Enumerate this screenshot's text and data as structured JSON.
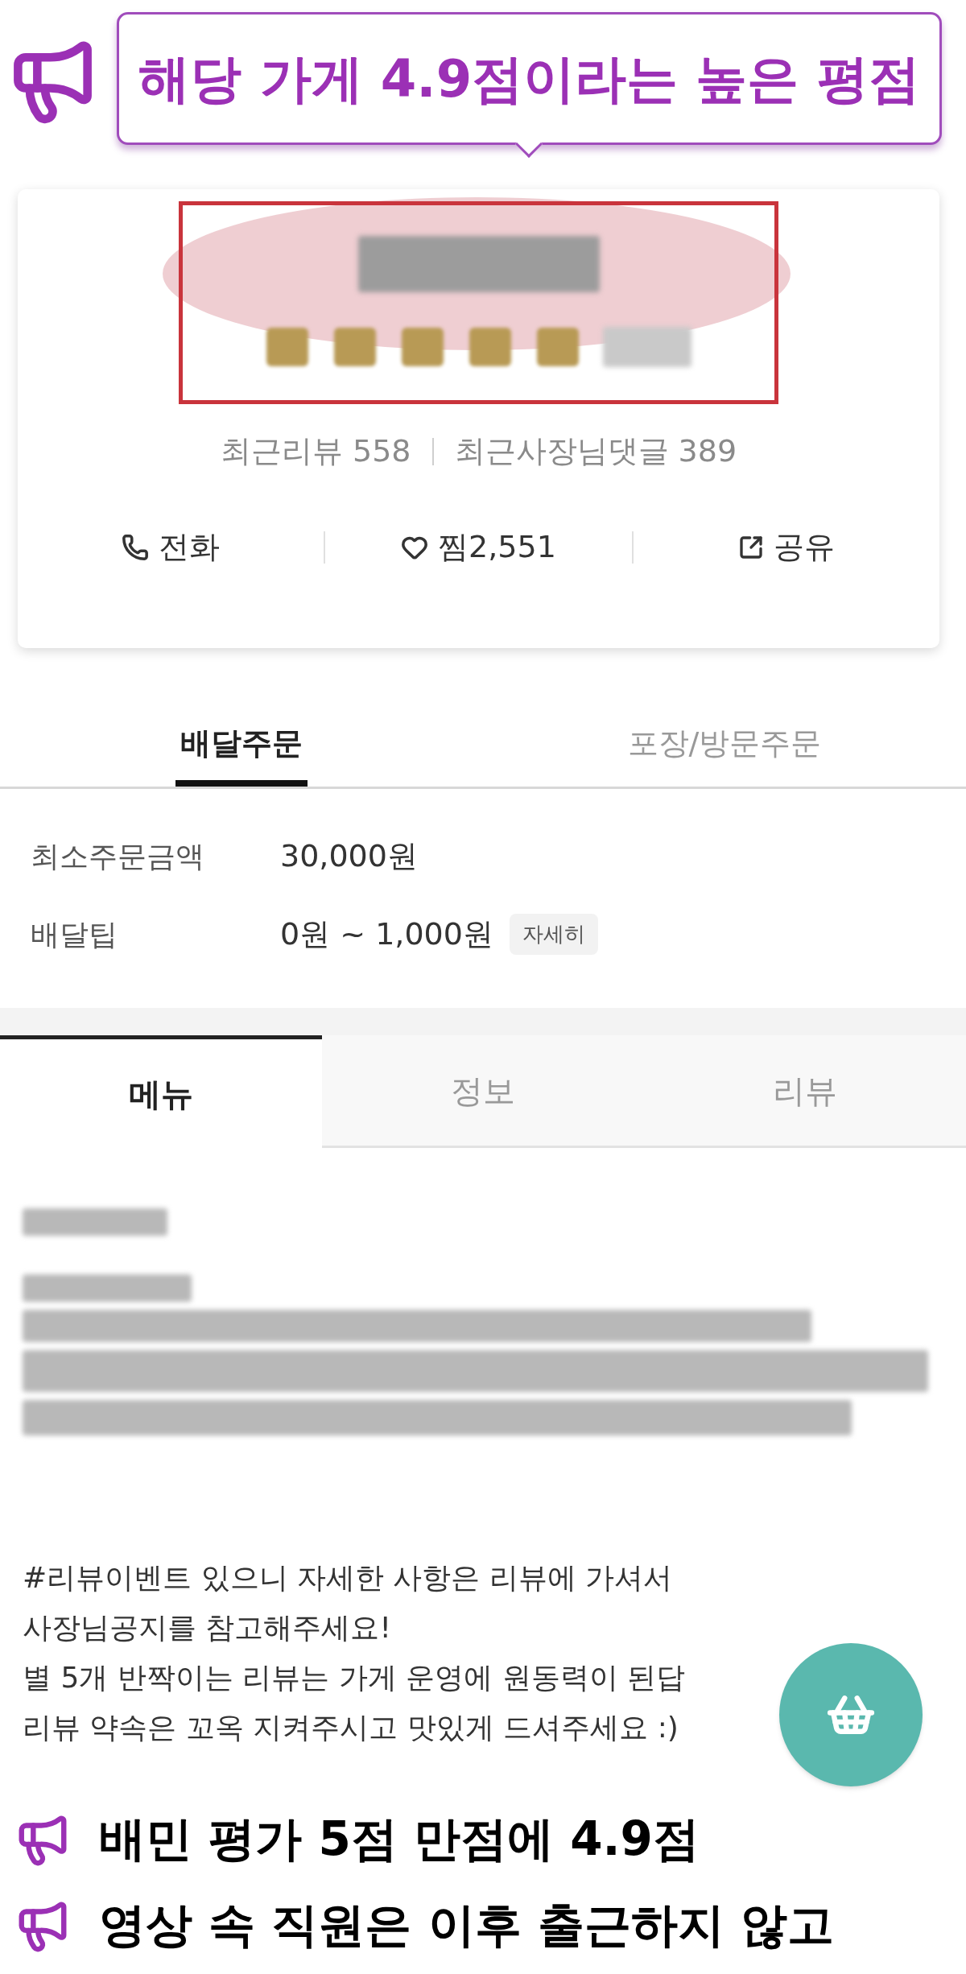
{
  "caption_top": {
    "text": "해당 가게 4.9점이라는 높은 평점"
  },
  "store_card": {
    "review_stats": [
      "최근리뷰 558",
      "최근사장님댓글 389"
    ],
    "actions": [
      {
        "kind": "phone",
        "label": "전화"
      },
      {
        "kind": "heart",
        "label": "찜2,551"
      },
      {
        "kind": "share",
        "label": "공유"
      }
    ]
  },
  "order_tabs": [
    {
      "label": "배달주문",
      "selected": true
    },
    {
      "label": "포장/방문주문",
      "selected": false
    }
  ],
  "order_info": [
    {
      "label": "최소주문금액",
      "value": "30,000원"
    },
    {
      "label": "배달팁",
      "value": "0원 ~ 1,000원",
      "badge": "자세히"
    }
  ],
  "menu_tabs": [
    {
      "label": "메뉴",
      "selected": true
    },
    {
      "label": "정보",
      "selected": false
    },
    {
      "label": "리뷰",
      "selected": false
    }
  ],
  "notice_lines": [
    "#리뷰이벤트 있으니 자세한 사항은 리뷰에 가셔서",
    "사장님공지를 참고해주세요!",
    "별 5개 반짝이는 리뷰는 가게 운영에 원동력이 된답",
    "리뷰 약속은 꼬옥 지켜주시고 맛있게 드셔주세요 :)"
  ],
  "captions_bottom": [
    "배민 평가 5점 만점에 4.9점",
    "영상 속 직원은 이후 출근하지 않고"
  ]
}
